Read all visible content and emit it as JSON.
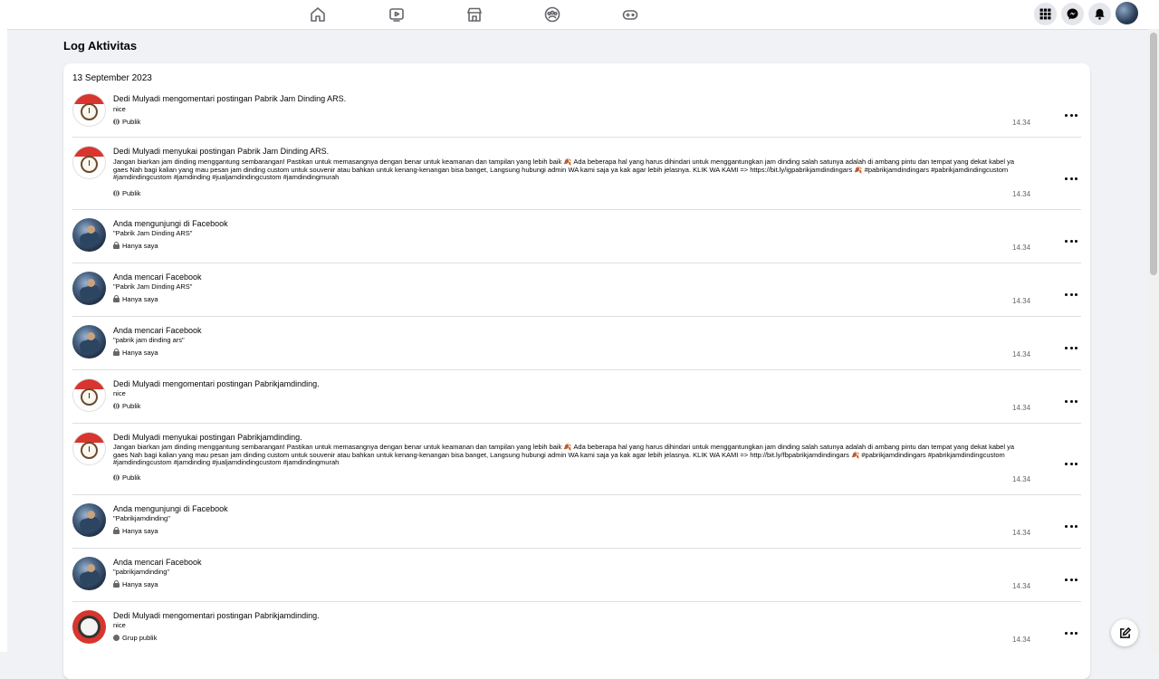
{
  "page_title": "Log Aktivitas",
  "date_header": "13 September 2023",
  "nav_icons": [
    "home-icon",
    "watch-icon",
    "marketplace-icon",
    "groups-icon",
    "gaming-icon"
  ],
  "right_icons": [
    "menu-grid-icon",
    "messenger-icon",
    "notifications-icon",
    "profile-avatar"
  ],
  "entries": [
    {
      "avatar": "clock",
      "title": "Dedi Mulyadi mengomentari postingan Pabrik Jam Dinding ARS.",
      "detail": "nice",
      "privacy": "Publik",
      "privacy_icon": "globe",
      "time": "14.34"
    },
    {
      "avatar": "clock",
      "title": "Dedi Mulyadi menyukai postingan Pabrik Jam Dinding ARS.",
      "detail": "Jangan biarkan jam dinding menggantung sembarangan! Pastikan untuk memasangnya dengan benar untuk keamanan dan tampilan yang lebih baik 🍂 Ada beberapa hal yang harus dihindari untuk menggantungkan jam dinding salah satunya adalah di ambang pintu dan tempat yang dekat kabel ya gaes Nah bagi kalian yang mau pesan jam dinding custom untuk souvenir atau bahkan untuk kenang-kenangan bisa banget, Langsung hubungi admin WA kami saja ya kak agar lebih jelasnya. KLIK WA KAMI => https://bit.ly/igpabrikjamdindingars 🍂 #pabrikjamdindingars #pabrikjamdindingcustom #jamdindingcustom #jamdinding #jualjamdindingcustom #jamdindingmurah",
      "privacy": "Publik",
      "privacy_icon": "globe",
      "time": "14.34"
    },
    {
      "avatar": "person",
      "title": "Anda mengunjungi di Facebook",
      "detail": "\"Pabrik Jam Dinding ARS\"",
      "privacy": "Hanya saya",
      "privacy_icon": "lock",
      "time": "14.34"
    },
    {
      "avatar": "person",
      "title": "Anda mencari Facebook",
      "detail": "\"Pabrik Jam Dinding ARS\"",
      "privacy": "Hanya saya",
      "privacy_icon": "lock",
      "time": "14.34"
    },
    {
      "avatar": "person",
      "title": "Anda mencari Facebook",
      "detail": "\"pabrik jam dinding ars\"",
      "privacy": "Hanya saya",
      "privacy_icon": "lock",
      "time": "14.34"
    },
    {
      "avatar": "clock",
      "title": "Dedi Mulyadi mengomentari postingan Pabrikjamdinding.",
      "detail": "nice",
      "privacy": "Publik",
      "privacy_icon": "globe",
      "time": "14.34"
    },
    {
      "avatar": "clock",
      "title": "Dedi Mulyadi menyukai postingan Pabrikjamdinding.",
      "detail": "Jangan biarkan jam dinding menggantung sembarangan! Pastikan untuk memasangnya dengan benar untuk keamanan dan tampilan yang lebih baik 🍂 Ada beberapa hal yang harus dihindari untuk menggantungkan jam dinding salah satunya adalah di ambang pintu dan tempat yang dekat kabel ya gaes Nah bagi kalian yang mau pesan jam dinding custom untuk souvenir atau bahkan untuk kenang-kenangan bisa banget, Langsung hubungi admin WA kami saja ya kak agar lebih jelasnya. KLIK WA KAMI => http://bit.ly/fbpabrikjamdindingars 🍂 #pabrikjamdindingars #pabrikjamdindingcustom #jamdindingcustom #jamdinding #jualjamdindingcustom #jamdindingmurah",
      "privacy": "Publik",
      "privacy_icon": "globe",
      "time": "14.34"
    },
    {
      "avatar": "person",
      "title": "Anda mengunjungi di Facebook",
      "detail": "\"Pabrikjamdinding\"",
      "privacy": "Hanya saya",
      "privacy_icon": "lock",
      "time": "14.34"
    },
    {
      "avatar": "person",
      "title": "Anda mencari Facebook",
      "detail": "\"pabrikjamdinding\"",
      "privacy": "Hanya saya",
      "privacy_icon": "lock",
      "time": "14.34"
    },
    {
      "avatar": "group",
      "title": "Dedi Mulyadi mengomentari postingan Pabrikjamdinding.",
      "detail": "nice",
      "privacy": "Grup publik",
      "privacy_icon": "group",
      "time": "14.34"
    }
  ]
}
